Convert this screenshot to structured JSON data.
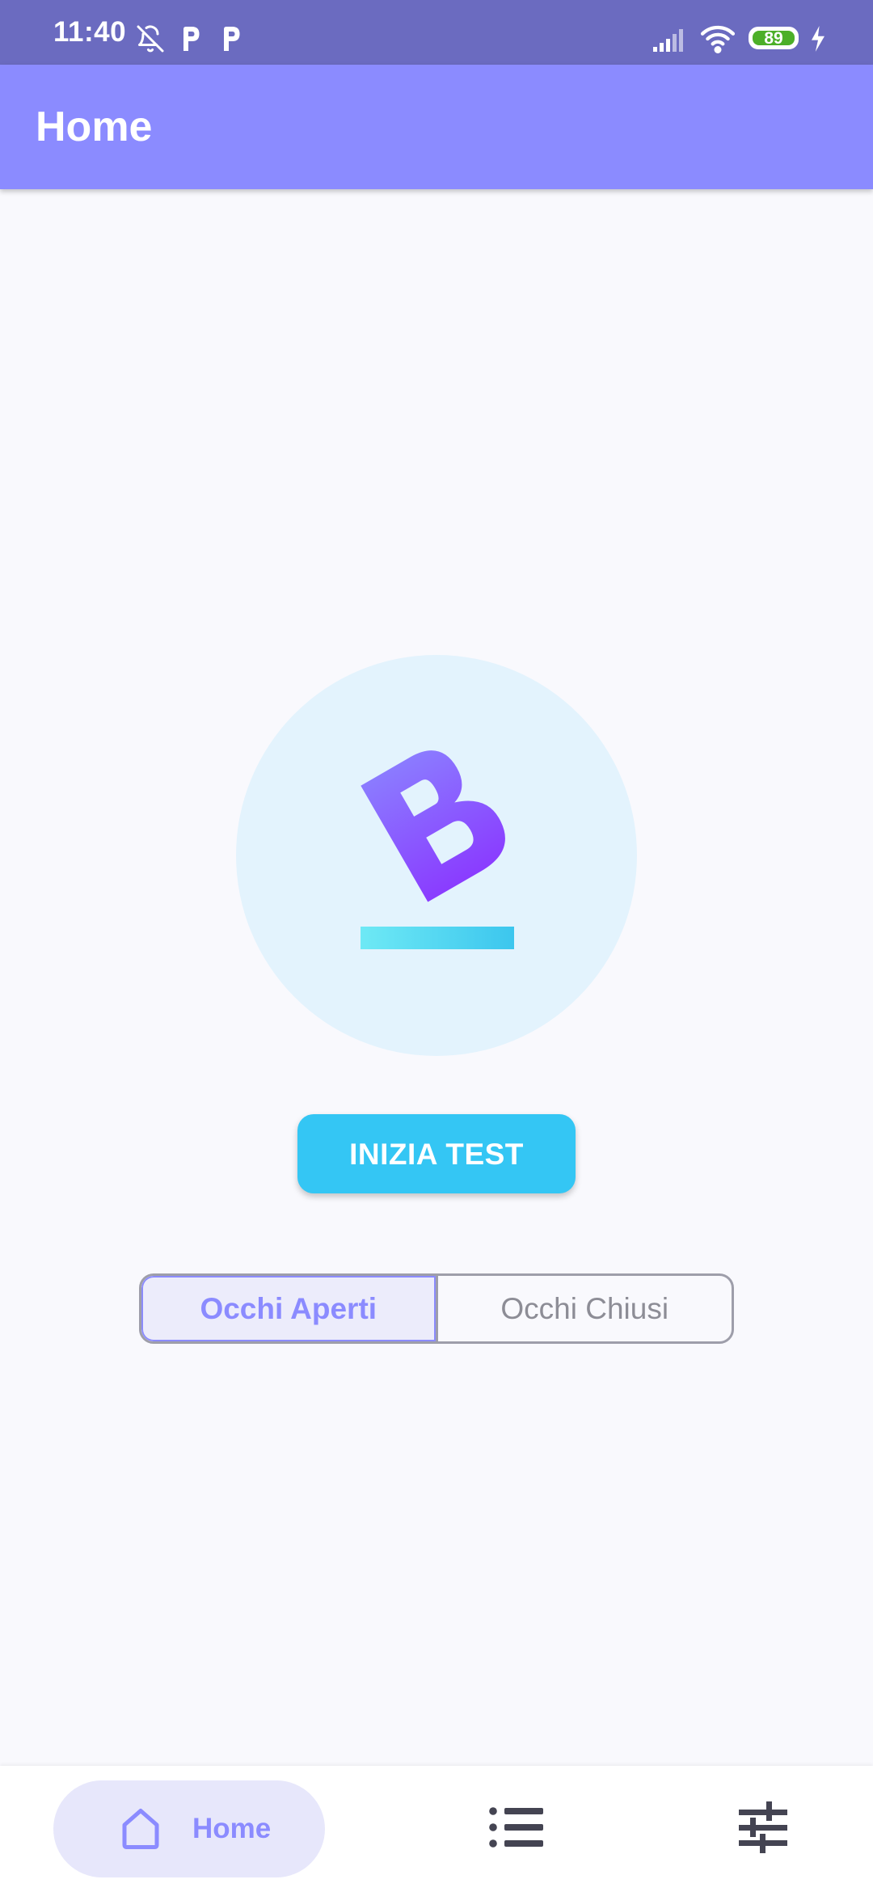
{
  "status_bar": {
    "time": "11:40",
    "battery_level": "89",
    "icons": [
      "bell-off-icon",
      "parking-icon",
      "parking-icon",
      "signal-icon",
      "wifi-icon",
      "battery-icon",
      "charging-icon"
    ]
  },
  "app_bar": {
    "title": "Home"
  },
  "logo": {
    "icon": "b-logo-icon",
    "colors": {
      "circle": "#e3f3fd",
      "letter_top": "#8b7bff",
      "letter_bottom": "#8a3cff",
      "bar_left": "#6ee9f5",
      "bar_right": "#3cc6ee"
    }
  },
  "actions": {
    "start_button_label": "INIZIA TEST"
  },
  "mode_toggle": {
    "options": [
      {
        "label": "Occhi Aperti",
        "selected": true
      },
      {
        "label": "Occhi Chiusi",
        "selected": false
      }
    ]
  },
  "bottom_nav": {
    "items": [
      {
        "label": "Home",
        "icon": "home-icon",
        "active": true
      },
      {
        "label": "",
        "icon": "list-icon",
        "active": false
      },
      {
        "label": "",
        "icon": "sliders-icon",
        "active": false
      }
    ]
  },
  "colors": {
    "primary": "#8b8bff",
    "status_bar": "#6b6bc0",
    "accent": "#34c6f4",
    "background": "#f9f9fd"
  }
}
